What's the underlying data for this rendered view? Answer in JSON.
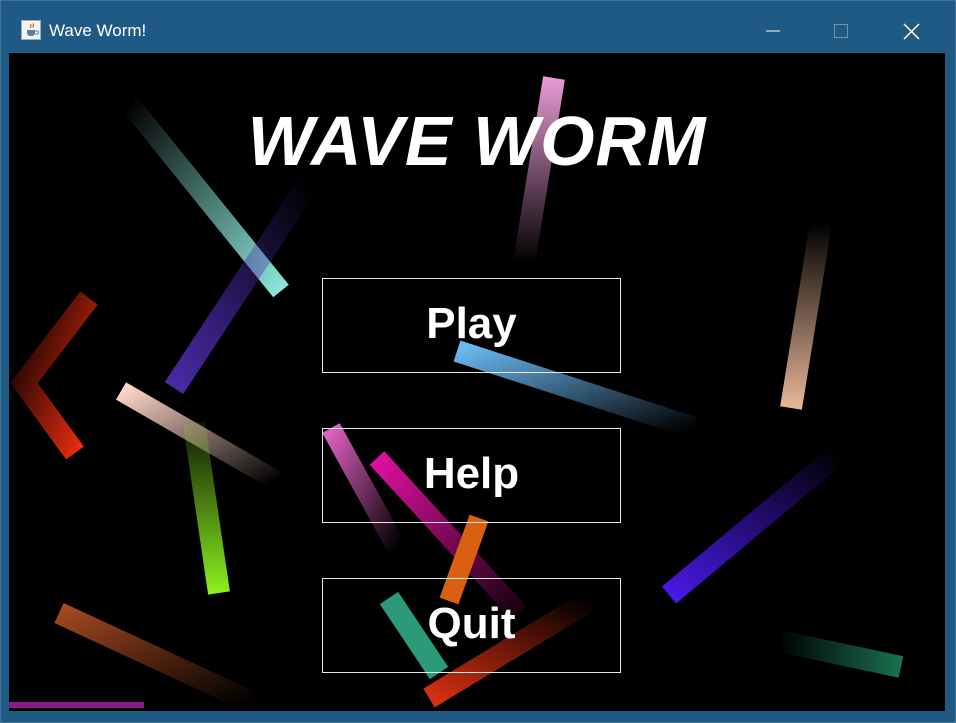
{
  "window": {
    "title": "Wave Worm!",
    "icon": "java-cup-icon",
    "controls": [
      "minimize-icon",
      "maximize-icon",
      "close-icon"
    ]
  },
  "game": {
    "title": "WAVE WORM",
    "menu": {
      "play_label": "Play",
      "help_label": "Help",
      "quit_label": "Quit"
    }
  },
  "colors": {
    "titlebar": "#1f5a84",
    "background": "#000000",
    "text": "#ffffff",
    "button_border": "#e6e6e6"
  }
}
